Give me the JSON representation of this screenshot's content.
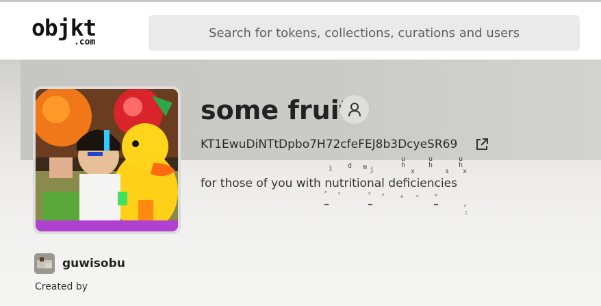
{
  "header": {
    "logo_main": "objkt",
    "logo_sub": ".com",
    "search_placeholder": "Search for tokens, collections, curations and users"
  },
  "collection": {
    "title": "some fruit",
    "contract_address": "KT1EwuDiNTtDpbo7H72cfeFEJ8b3DcyeSR69",
    "description": "for those of you with nutritional deficiencies",
    "image_icon": "collection-thumbnail",
    "owner_icon": "user-icon",
    "address_link_icon": "external-link-icon"
  },
  "creator": {
    "name": "guwisobu",
    "role_label": "Created by",
    "avatar_icon": "creator-avatar"
  },
  "colors": {
    "header_bg": "#ffffff",
    "search_bg": "#eaeaea",
    "banner_bg": "#e4e3e0",
    "text": "#222222"
  }
}
